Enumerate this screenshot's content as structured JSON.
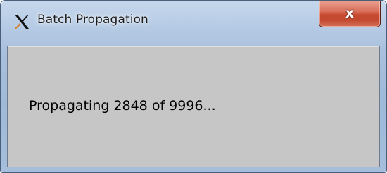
{
  "window": {
    "title": "Batch Propagation",
    "app_icon": "x-logo-icon",
    "close_icon": "close-icon",
    "close_glyph": "x"
  },
  "dialog": {
    "message": "Propagating 2848 of 9996..."
  },
  "progress": {
    "current": 2848,
    "total": 9996
  },
  "colors": {
    "frame": "#a9c0dd",
    "close_button": "#c74a2f",
    "client_background": "#c6c6c6"
  }
}
